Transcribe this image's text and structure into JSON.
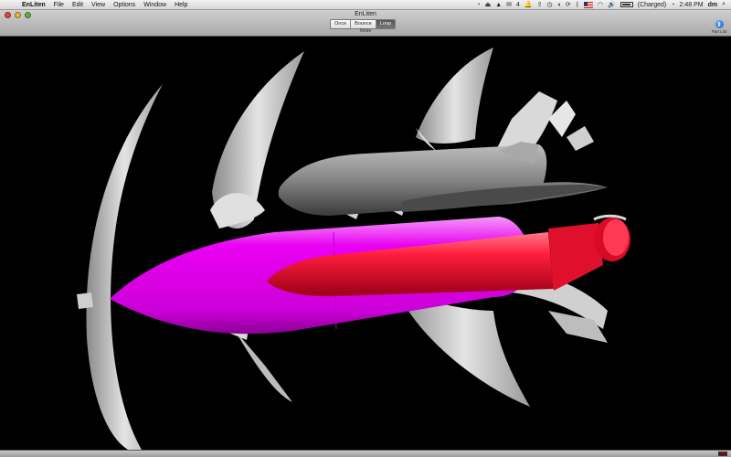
{
  "menubar": {
    "app_name": "EnLiten",
    "items": [
      "File",
      "Edit",
      "View",
      "Options",
      "Window",
      "Help"
    ],
    "status": {
      "m_label": "4",
      "battery_label": "(Charged)",
      "clock": "2:48 PM",
      "user": "dm"
    }
  },
  "window": {
    "title": "EnLiten"
  },
  "toolbar": {
    "mode_buttons": [
      "Once",
      "Bounce",
      "Loop"
    ],
    "active_mode": "Loop",
    "mode_label": "Mode",
    "part_list_label": "Part List"
  },
  "colors": {
    "tank": "#e600f0",
    "booster": "#ee1133",
    "orbiter": "#8c8c8c",
    "shock": "#d6d6d6",
    "background": "#000000"
  }
}
